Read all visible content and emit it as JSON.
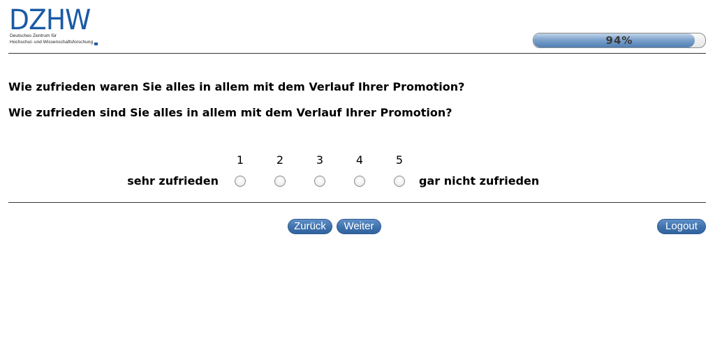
{
  "header": {
    "logo": {
      "mark": "DZHW",
      "line1": "Deutsches Zentrum für",
      "line2": "Hochschul- und Wissenschaftsforschung"
    },
    "progress": {
      "value": 0.94,
      "label": "94%"
    }
  },
  "questions": [
    "Wie zufrieden waren Sie alles in allem mit dem Verlauf Ihrer Promotion?",
    "Wie zufrieden sind Sie alles in allem mit dem Verlauf Ihrer Promotion?"
  ],
  "scale": {
    "left_label": "sehr zufrieden",
    "right_label": "gar nicht zufrieden",
    "options": [
      "1",
      "2",
      "3",
      "4",
      "5"
    ],
    "selected": null
  },
  "navigation": {
    "back_label": "Zurück",
    "next_label": "Weiter",
    "logout_label": "Logout"
  },
  "colors": {
    "brand": "#1a5aa5",
    "button": "#3f72ad",
    "progress_fill": "#4f7fb5"
  }
}
